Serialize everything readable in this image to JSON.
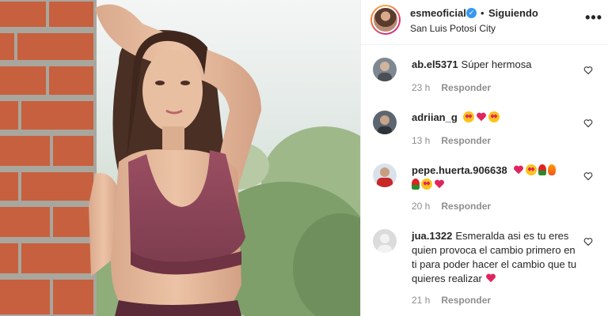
{
  "header": {
    "username": "esmeoficial",
    "follow_label": "Siguiendo",
    "separator": "•",
    "location": "San Luis Potosí City",
    "more_label": "•••",
    "verified_mark": "✓"
  },
  "comments": [
    {
      "username": "ab.el5371",
      "text": "Súper hermosa",
      "emoji": [],
      "time": "23 h",
      "reply_label": "Responder",
      "avatar_color": "#7f8791"
    },
    {
      "username": "adriian_g",
      "text": "",
      "emoji": [
        "love",
        "heart",
        "love"
      ],
      "time": "13 h",
      "reply_label": "Responder",
      "avatar_color": "#5d6670"
    },
    {
      "username": "pepe.huerta.906638",
      "text": "",
      "emoji": [
        "heart",
        "love",
        "rose",
        "fire",
        "rose",
        "love",
        "heart"
      ],
      "time": "20 h",
      "reply_label": "Responder",
      "avatar_color": "#c62828"
    },
    {
      "username": "jua.1322",
      "text": "Esmeralda asi es tu eres quien provoca el cambio primero en ti para poder hacer el cambio que tu quieres realizar",
      "emoji": [
        "heart"
      ],
      "time": "21 h",
      "reply_label": "Responder",
      "avatar_color": "#dbdbdb"
    }
  ],
  "colors": {
    "accent": "#3897f0",
    "muted": "#8e8e8e",
    "heart_emoji": "#e0245e"
  },
  "icons": {
    "like": "heart-outline-icon",
    "verified": "verified-badge-icon",
    "more": "more-options-icon"
  }
}
